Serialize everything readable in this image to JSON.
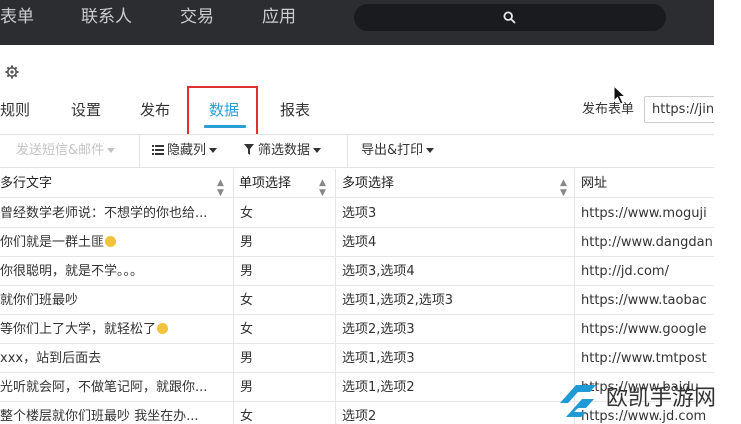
{
  "topnav": {
    "items": [
      "表单",
      "联系人",
      "交易",
      "应用"
    ],
    "search_icon": "search-icon"
  },
  "tabs": {
    "items": [
      "规则",
      "设置",
      "发布",
      "数据",
      "报表"
    ],
    "active": "数据"
  },
  "publish": {
    "label": "发布表单",
    "url": "https://jin"
  },
  "toolbar": {
    "send_sms": "发送短信&邮件",
    "hide_columns": "隐藏列",
    "filter_data": "筛选数据",
    "export_print": "导出&打印"
  },
  "table": {
    "headers": [
      "多行文字",
      "单项选择",
      "多项选择",
      "网址"
    ],
    "rows": [
      [
        "曾经数学老师说：不想学的你也给...",
        "女",
        "选项3",
        "https://www.moguji"
      ],
      [
        "你们就是一群土匪",
        "男",
        "选项4",
        "http://www.dangdan"
      ],
      [
        "你很聪明，就是不学。。。",
        "男",
        "选项3,选项4",
        "http://jd.com/"
      ],
      [
        "就你们班最吵",
        "女",
        "选项1,选项2,选项3",
        "https://www.taobac"
      ],
      [
        "等你们上了大学，就轻松了",
        "女",
        "选项2,选项3",
        "https://www.google"
      ],
      [
        "xxx，站到后面去",
        "男",
        "选项1,选项3",
        "http://www.tmtpost"
      ],
      [
        "光听就会阿，不做笔记阿，就跟你...",
        "男",
        "选项1,选项2",
        "https://www.baidu"
      ],
      [
        "整个楼层就你们班最吵 我坐在办...",
        "女",
        "选项2",
        "https://www.jd.com"
      ]
    ]
  },
  "watermark": {
    "text": "欧凯手游网"
  },
  "colors": {
    "topbar": "#2b2d31",
    "accent": "#2a9fd6",
    "highlight": "#e0302e"
  }
}
